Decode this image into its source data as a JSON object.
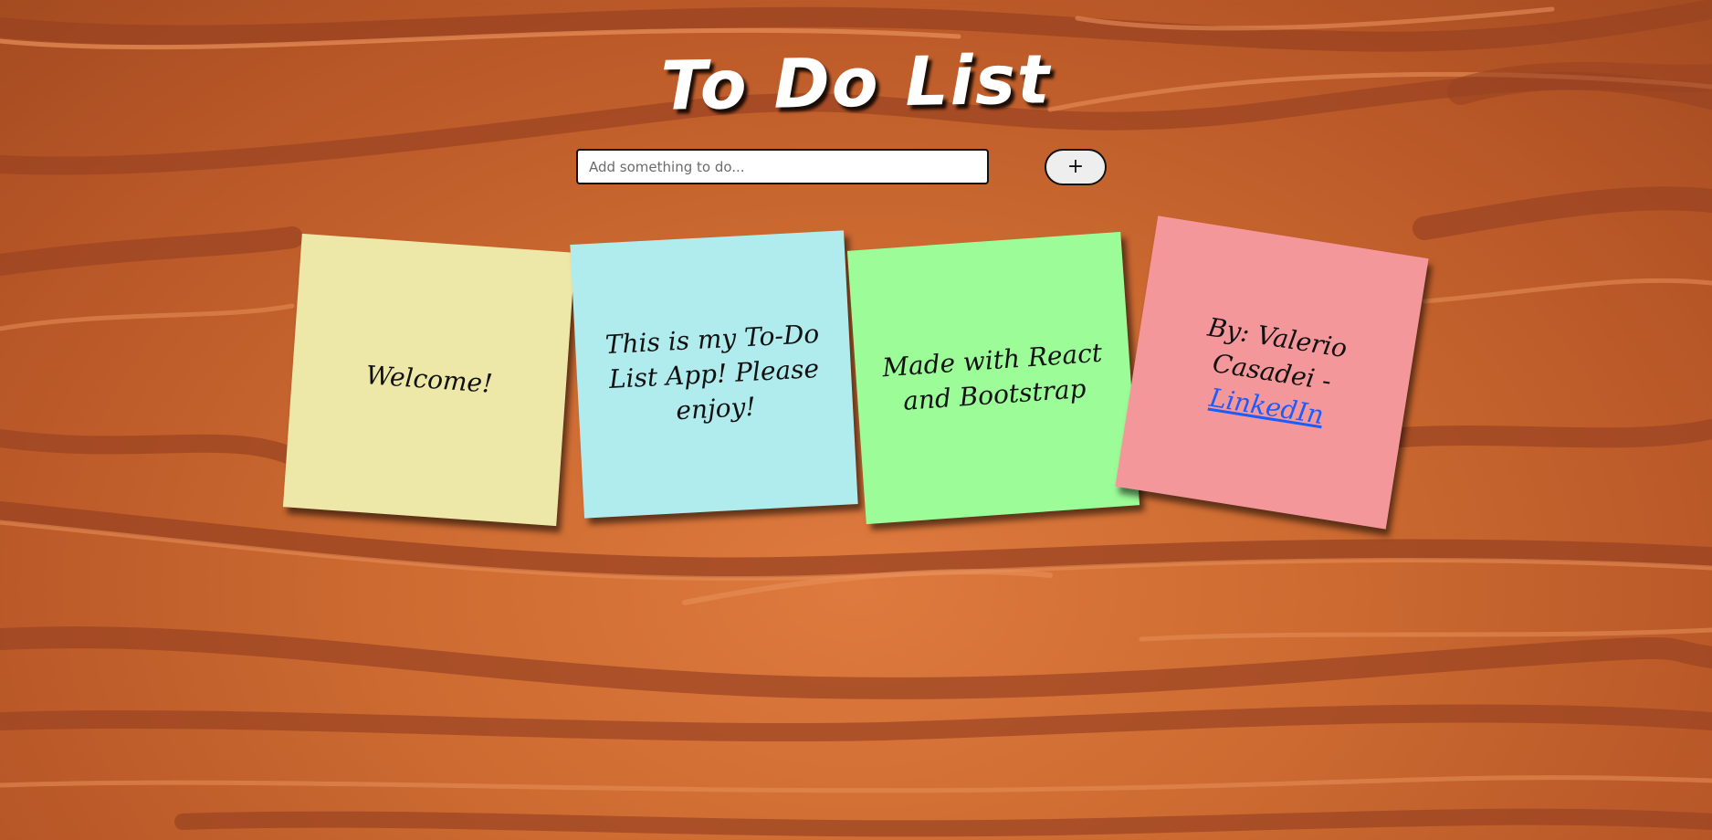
{
  "header": {
    "title": "To Do List"
  },
  "add_form": {
    "placeholder": "Add something to do...",
    "add_button_label": "+"
  },
  "notes": [
    {
      "text": "Welcome!",
      "color": "#ede8a8"
    },
    {
      "text": "This is my To-Do List App! Please enjoy!",
      "color": "#b0ecee"
    },
    {
      "text": "Made with React and Bootstrap",
      "color": "#9bfc98"
    },
    {
      "text": "By: Valerio Casadei - ",
      "link_text": "LinkedIn",
      "color": "#f4979b"
    }
  ],
  "colors": {
    "background": "#cc6a31",
    "wood_grain_dark": "#9a4322",
    "wood_grain_light": "#e8905a",
    "title": "#ffffff",
    "link": "#1a5cff"
  }
}
